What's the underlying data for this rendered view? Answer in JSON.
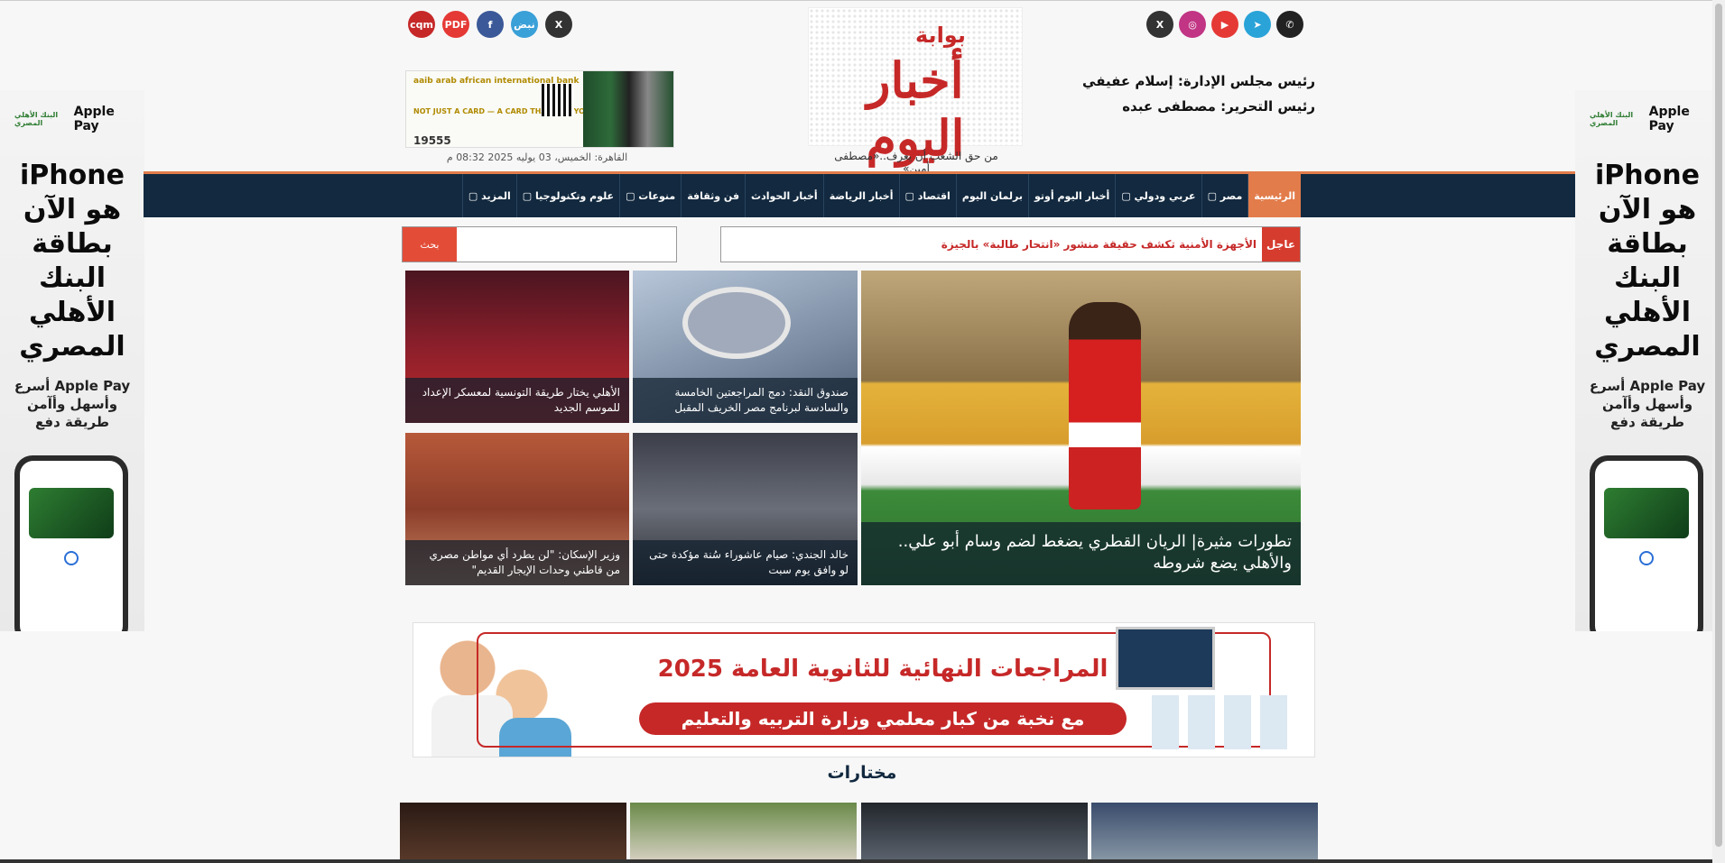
{
  "header": {
    "chairman": "رئيس مجلس الإدارة: إسلام عفيفي",
    "editor": "رئيس التحرير: مصطفى عبده",
    "slogan": "من حق الشعب أن يعرف..«مصطفى أمين»",
    "date": "القاهرة: الخميس، 03 يوليه 2025 08:32 م",
    "logo_small": "بوابة",
    "logo_main": "أخبار اليوم"
  },
  "social_right": [
    {
      "name": "x-icon",
      "label": "X",
      "color": "#333333"
    },
    {
      "name": "instagram-icon",
      "label": "◎",
      "color": "#c13584"
    },
    {
      "name": "youtube-icon",
      "label": "▶",
      "color": "#e53935"
    },
    {
      "name": "telegram-icon",
      "label": "➤",
      "color": "#2aa3d8"
    },
    {
      "name": "whatsapp-icon",
      "label": "✆",
      "color": "#222222"
    }
  ],
  "social_left": [
    {
      "name": "cqm-icon",
      "label": "cqm",
      "color": "#c62828"
    },
    {
      "name": "pdf-icon",
      "label": "PDF",
      "color": "#e53935"
    },
    {
      "name": "facebook-icon",
      "label": "f",
      "color": "#3b5998"
    },
    {
      "name": "nabd-icon",
      "label": "نبض",
      "color": "#3aa0d8"
    },
    {
      "name": "x-icon",
      "label": "X",
      "color": "#333333"
    }
  ],
  "header_ad": {
    "bank": "aaib arab african international bank",
    "slogan": "NOT JUST A CARD — A CARD THAT FITS YOUR LIFESTYLE",
    "phone": "19555"
  },
  "nav": [
    {
      "label": "الرئيسية",
      "active": true
    },
    {
      "label": "مصر ▢",
      "active": false
    },
    {
      "label": "عربي ودولي ▢",
      "active": false
    },
    {
      "label": "أخبار اليوم أوتو",
      "active": false
    },
    {
      "label": "برلمان اليوم",
      "active": false
    },
    {
      "label": "اقتصاد ▢",
      "active": false
    },
    {
      "label": "أخبار الرياضة",
      "active": false
    },
    {
      "label": "أخبار الحوادث",
      "active": false
    },
    {
      "label": "فن وثقافة",
      "active": false
    },
    {
      "label": "منوعات ▢",
      "active": false
    },
    {
      "label": "علوم وتكنولوجيا ▢",
      "active": false
    },
    {
      "label": "المزيد ▢",
      "active": false
    }
  ],
  "breaking": {
    "label": "عاجل",
    "text": "الأجهزة الأمنية تكشف حقيقة منشور «انتحار طالبة» بالجيزة"
  },
  "search": {
    "button": "بحث",
    "placeholder": ""
  },
  "news": {
    "main": "تطورات مثيرة| الريان القطري يضغط لضم وسام أبو علي.. والأهلي يضع شروطه",
    "item1": "صندوق النقد: دمج المراجعتين الخامسة والسادسة لبرنامج مصر الخريف المقبل",
    "item2": "الأهلي يختار طريقة التونسية لمعسكر الإعداد للموسم الجديد",
    "item3": "خالد الجندي: صيام عاشوراء سُنة مؤكدة حتى لو وافق يوم سبت",
    "item4": "وزير الإسكان: \"لن يطرد أي مواطن مصري من قاطني وحدات الإيجار القديم\""
  },
  "side_ad": {
    "bank": "البنك الأهلي المصري",
    "pay": "Apple Pay",
    "headline": [
      "iPhone",
      "هو الآن",
      "بطاقة",
      "البنك",
      "الأهلي",
      "المصري"
    ],
    "sub": [
      "Apple Pay أسرع",
      "وأسهل وأآمن",
      "طريقة دفع"
    ]
  },
  "banner": {
    "headline": "المراجعات النهائية للثانوية العامة 2025",
    "sub": "مع نخبة من كبار معلمي وزارة التربيه والتعليم"
  },
  "section": {
    "title": "مختارات"
  }
}
